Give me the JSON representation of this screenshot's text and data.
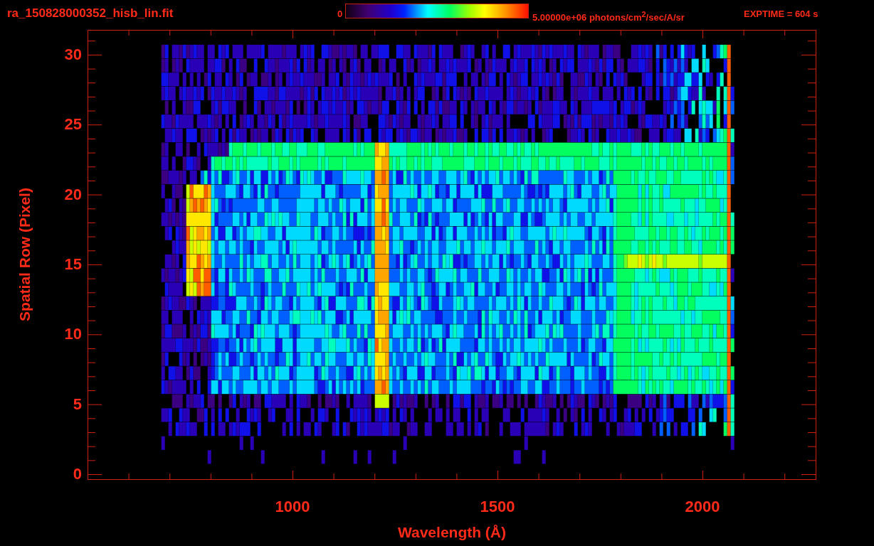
{
  "header": {
    "filename": "ra_150828000352_hisb_lin.fit",
    "colorbar": {
      "min_label": "0",
      "max_label": "5.00000e+06 photons/cm$^{2}$/sec/A/sr"
    },
    "exptime": "EXPTIME = 604 s"
  },
  "plot": {
    "y_axis": {
      "title": "Spatial Row (Pixel)",
      "tick_labels": [
        "30",
        "25",
        "20",
        "15",
        "10",
        "5",
        "0"
      ]
    },
    "x_axis": {
      "title": "Wavelength (Å)",
      "tick_labels": [
        "1000",
        "1500",
        "2000"
      ]
    }
  }
}
